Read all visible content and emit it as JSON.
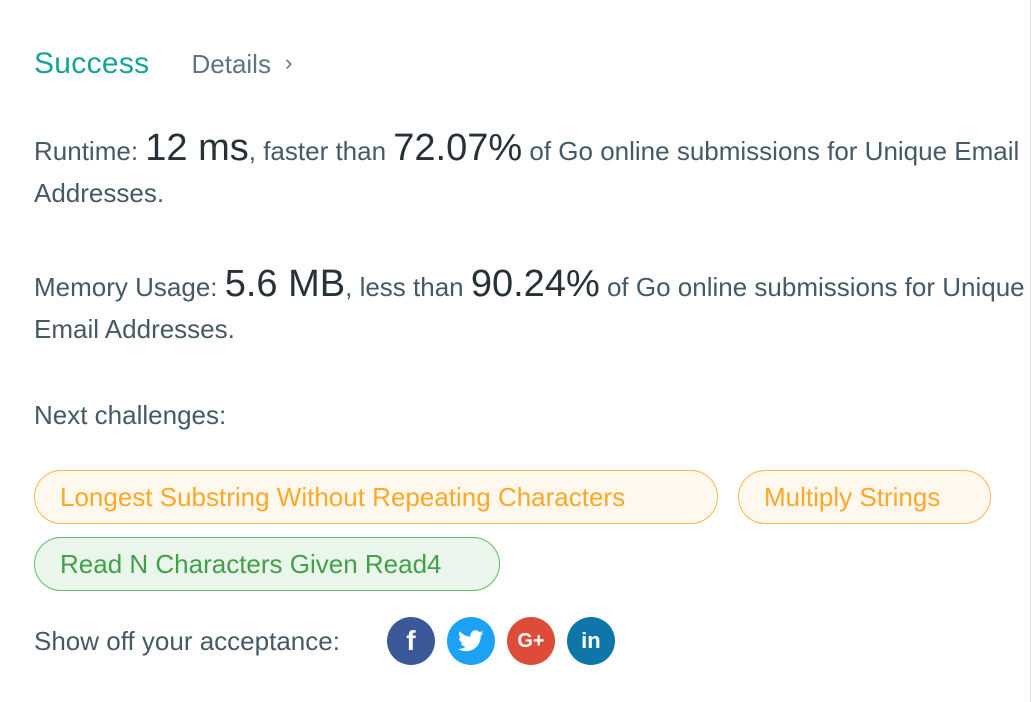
{
  "result": {
    "status": "Success",
    "details_label": "Details",
    "details_chevron": "›"
  },
  "runtime": {
    "label": "Runtime: ",
    "value": "12 ms",
    "comparison": ", faster than ",
    "percent": "72.07%",
    "suffix": " of Go online submissions for Unique Email Addresses."
  },
  "memory": {
    "label": "Memory Usage: ",
    "value": "5.6 MB",
    "comparison": ", less than ",
    "percent": "90.24%",
    "suffix": " of Go online submissions for Unique Email Addresses."
  },
  "next_challenges": {
    "label": "Next challenges:",
    "items": [
      {
        "title": "Longest Substring Without Repeating Characters",
        "difficulty": "medium"
      },
      {
        "title": "Multiply Strings",
        "difficulty": "medium"
      },
      {
        "title": "Read N Characters Given Read4",
        "difficulty": "easy"
      }
    ]
  },
  "share": {
    "label": "Show off your acceptance:",
    "buttons": [
      {
        "icon": "facebook-icon",
        "glyph": "f",
        "color": "#3b5998"
      },
      {
        "icon": "twitter-icon",
        "glyph": "",
        "color": "#1da1f2"
      },
      {
        "icon": "google-plus-icon",
        "glyph": "G+",
        "color": "#dd4b39"
      },
      {
        "icon": "linkedin-icon",
        "glyph": "in",
        "color": "#0e76a8"
      }
    ]
  },
  "colors": {
    "success": "#17a398",
    "medium": "#ffa726",
    "easy": "#43a047"
  }
}
